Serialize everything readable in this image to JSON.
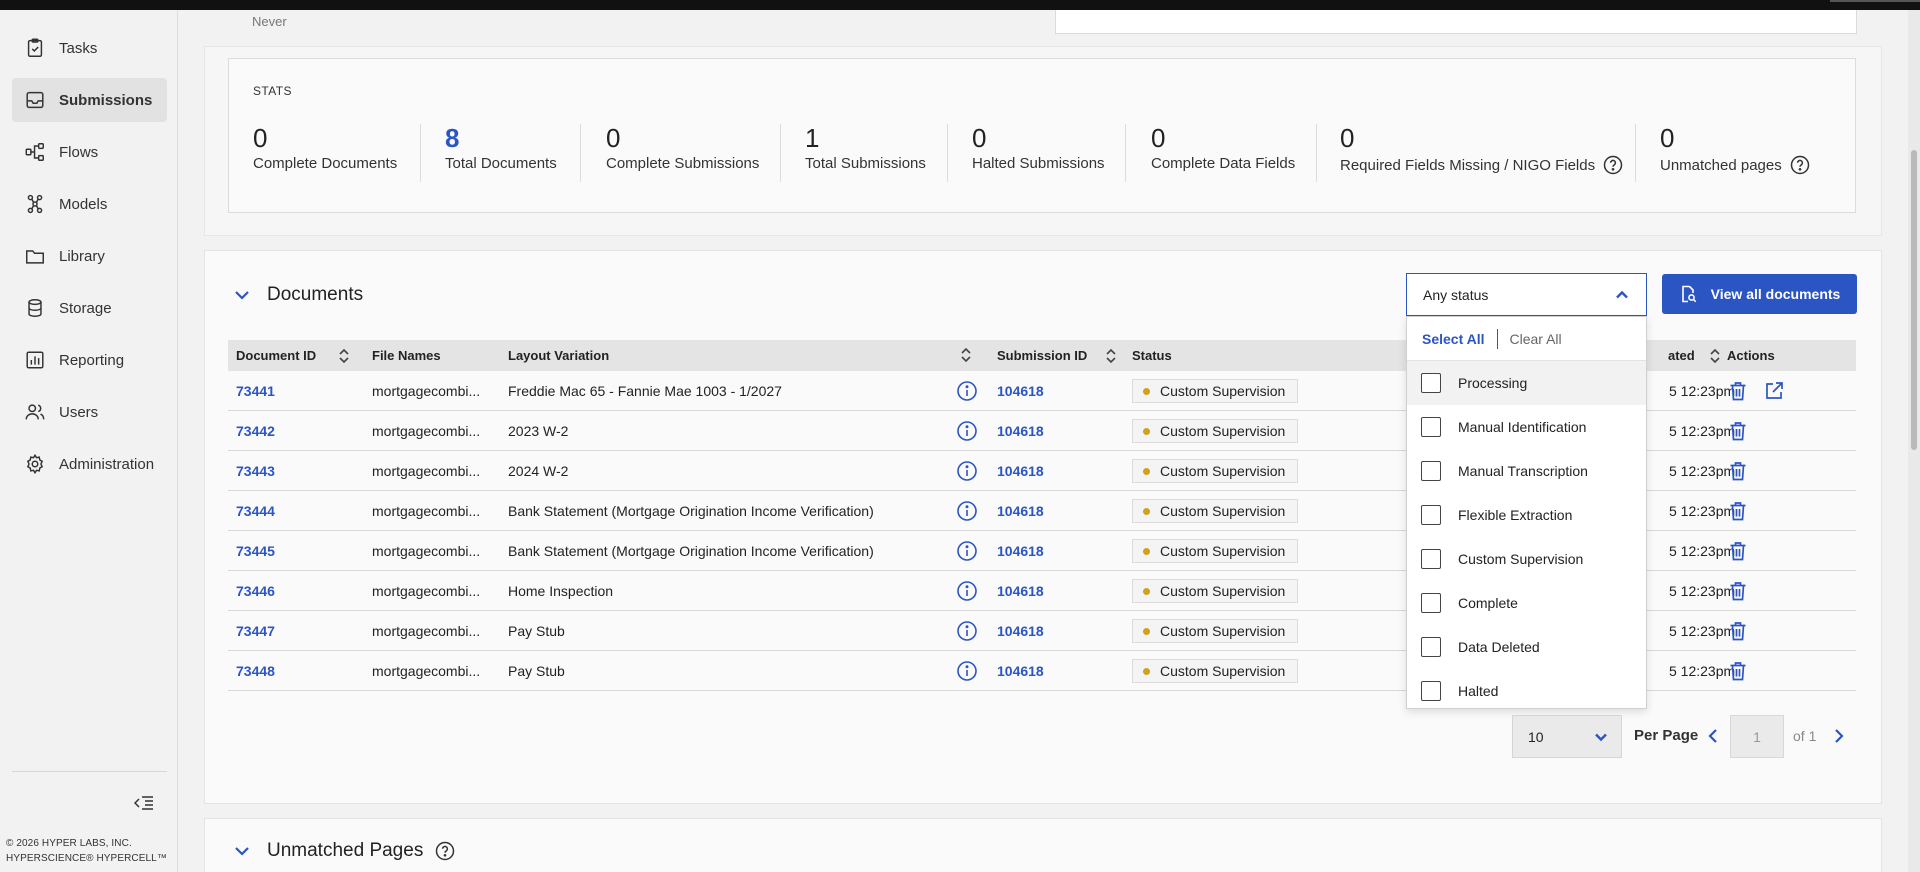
{
  "sidebar": {
    "items": [
      {
        "label": "Tasks",
        "icon": "clipboard-check-icon",
        "active": false
      },
      {
        "label": "Submissions",
        "icon": "inbox-icon",
        "active": true
      },
      {
        "label": "Flows",
        "icon": "flow-icon",
        "active": false
      },
      {
        "label": "Models",
        "icon": "models-icon",
        "active": false
      },
      {
        "label": "Library",
        "icon": "folder-icon",
        "active": false
      },
      {
        "label": "Storage",
        "icon": "database-icon",
        "active": false
      },
      {
        "label": "Reporting",
        "icon": "chart-icon",
        "active": false
      },
      {
        "label": "Users",
        "icon": "users-icon",
        "active": false
      },
      {
        "label": "Administration",
        "icon": "gear-icon",
        "active": false
      }
    ],
    "copyright_line1": "© 2026 HYPER LABS, INC.",
    "copyright_line2": "HYPERSCIENCE® HYPERCELL™"
  },
  "top": {
    "never_text": "Never"
  },
  "stats": {
    "label": "STATS",
    "items": [
      {
        "value": "0",
        "label": "Complete Documents"
      },
      {
        "value": "8",
        "label": "Total Documents"
      },
      {
        "value": "0",
        "label": "Complete Submissions"
      },
      {
        "value": "1",
        "label": "Total Submissions"
      },
      {
        "value": "0",
        "label": "Halted Submissions"
      },
      {
        "value": "0",
        "label": "Complete Data Fields"
      },
      {
        "value": "0",
        "label": "Required Fields Missing / NIGO Fields"
      },
      {
        "value": "0",
        "label": "Unmatched pages"
      }
    ]
  },
  "documents": {
    "title": "Documents",
    "view_all_label": "View all documents",
    "status_filter": {
      "value": "Any status",
      "select_all": "Select All",
      "clear_all": "Clear All",
      "options": [
        "Processing",
        "Manual Identification",
        "Manual Transcription",
        "Flexible Extraction",
        "Custom Supervision",
        "Complete",
        "Data Deleted",
        "Halted"
      ]
    },
    "columns": {
      "document_id": "Document ID",
      "file_names": "File Names",
      "layout_variation": "Layout Variation",
      "submission_id": "Submission ID",
      "status": "Status",
      "updated": "ated",
      "actions": "Actions"
    },
    "rows": [
      {
        "id": "73441",
        "file": "mortgagecombi...",
        "layout": "Freddie Mac 65 - Fannie Mae 1003 - 1/2027",
        "submission": "104618",
        "status": "Custom Supervision",
        "updated": "5 12:23pm"
      },
      {
        "id": "73442",
        "file": "mortgagecombi...",
        "layout": "2023 W-2",
        "submission": "104618",
        "status": "Custom Supervision",
        "updated": "5 12:23pm"
      },
      {
        "id": "73443",
        "file": "mortgagecombi...",
        "layout": "2024 W-2",
        "submission": "104618",
        "status": "Custom Supervision",
        "updated": "5 12:23pm"
      },
      {
        "id": "73444",
        "file": "mortgagecombi...",
        "layout": "Bank Statement (Mortgage Origination Income Verification)",
        "submission": "104618",
        "status": "Custom Supervision",
        "updated": "5 12:23pm"
      },
      {
        "id": "73445",
        "file": "mortgagecombi...",
        "layout": "Bank Statement (Mortgage Origination Income Verification)",
        "submission": "104618",
        "status": "Custom Supervision",
        "updated": "5 12:23pm"
      },
      {
        "id": "73446",
        "file": "mortgagecombi...",
        "layout": "Home Inspection",
        "submission": "104618",
        "status": "Custom Supervision",
        "updated": "5 12:23pm"
      },
      {
        "id": "73447",
        "file": "mortgagecombi...",
        "layout": "Pay Stub",
        "submission": "104618",
        "status": "Custom Supervision",
        "updated": "5 12:23pm"
      },
      {
        "id": "73448",
        "file": "mortgagecombi...",
        "layout": "Pay Stub",
        "submission": "104618",
        "status": "Custom Supervision",
        "updated": "5 12:23pm"
      }
    ],
    "pagination": {
      "per_page_value": "10",
      "per_page_label": "Per Page",
      "page_placeholder": "1",
      "of_label": "of 1"
    }
  },
  "unmatched": {
    "title": "Unmatched Pages"
  },
  "colors": {
    "accent": "#2c55c4",
    "status_dot": "#d4a017"
  }
}
